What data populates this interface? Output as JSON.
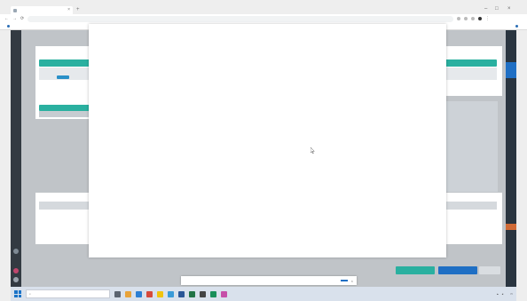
{
  "browser": {
    "tab_title": "",
    "new_tab": "+",
    "url": "",
    "bookmark_label": "",
    "right_label": ""
  },
  "page": {
    "section_products": "",
    "section_payment": "",
    "products_header_col1": "",
    "products_header_col2": "",
    "products_row_text": "",
    "products_row_right": "",
    "payment_header_col1": "",
    "payment_header_col2": "",
    "payment_row_text": "",
    "totals": [
      "",
      "",
      "",
      "",
      "",
      "",
      "",
      "",
      "",
      ""
    ],
    "fields": {
      "label1": "",
      "label2": "",
      "label3": "",
      "label4": ""
    },
    "buttons": {
      "primary": "",
      "secondary": "",
      "tertiary": ""
    }
  },
  "cookie_banner": {
    "text": "",
    "accept": ""
  },
  "taskbar": {
    "search_placeholder": "",
    "time": "",
    "date": "",
    "tray_text": ""
  },
  "colors": {
    "teal": "#2ab0a0",
    "blue": "#1f6fc4",
    "overlay_gray": "#c0c4c8"
  }
}
